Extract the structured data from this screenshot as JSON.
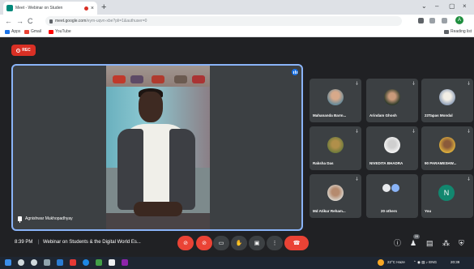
{
  "browser": {
    "tab_title": "Meet - Webinar on Studen",
    "tab_close": "×",
    "new_tab": "+",
    "window_controls": [
      "⌄",
      "–",
      "▢",
      "×"
    ],
    "nav": [
      "←",
      "→",
      "C"
    ],
    "url_host": "meet.google.com",
    "url_path": "/eym-uqvn-xbe?pli=1&authuser=0",
    "profile_letter": "A",
    "bookmarks": [
      {
        "label": "Apps",
        "icon": "apps-grid-icon",
        "color": "#1a73e8"
      },
      {
        "label": "Gmail",
        "icon": "gmail-icon",
        "color": "#ea4335"
      },
      {
        "label": "YouTube",
        "icon": "youtube-icon",
        "color": "#ff0000"
      }
    ],
    "reading_list": "Reading list"
  },
  "recording": {
    "label": "REC",
    "color": "#d93025"
  },
  "main_participant": {
    "name": "Agnishwar Mukhopadhyay",
    "border_color": "#8ab4f8"
  },
  "participants": [
    {
      "name": "Mahananda Barm...",
      "avatar": "photo"
    },
    {
      "name": "Arindam Ghosh",
      "avatar": "photo"
    },
    {
      "name": "23Tapas Mondal",
      "avatar": "photo"
    },
    {
      "name": "Raksha Das",
      "avatar": "photo"
    },
    {
      "name": "NIVEDITA BHADRA",
      "avatar": "photo"
    },
    {
      "name": "90 PARAMESHW...",
      "avatar": "photo"
    },
    {
      "name": "Md Atikur Reham...",
      "avatar": "photo"
    },
    {
      "name": "20 others",
      "avatar": "group"
    },
    {
      "name": "You",
      "avatar": "letter",
      "letter": "N"
    }
  ],
  "bottom": {
    "time": "8:39 PM",
    "separator": "|",
    "title": "Webinar on Students & the Digital World Es...",
    "people_count": "28"
  },
  "taskbar": {
    "weather": "22°C Haze",
    "time": "20:39"
  }
}
